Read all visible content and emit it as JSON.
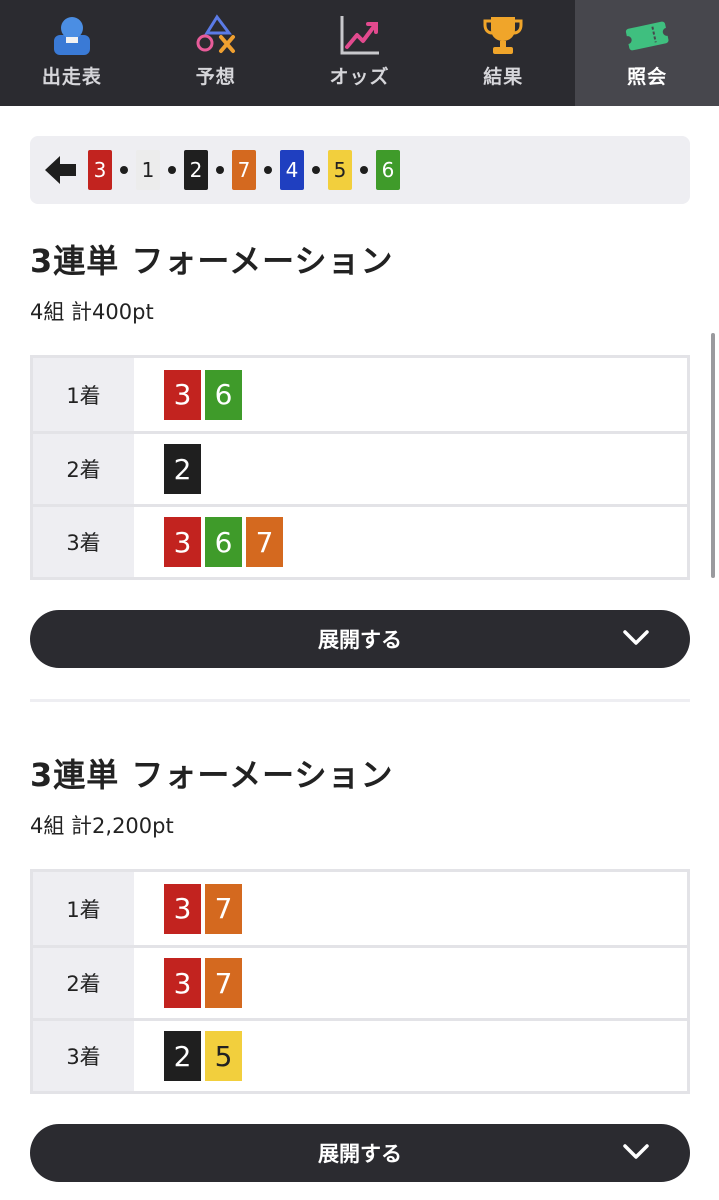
{
  "nav": {
    "items": [
      {
        "label": "出走表",
        "icon": "person-icon",
        "active": false
      },
      {
        "label": "予想",
        "icon": "prediction-icon",
        "active": false
      },
      {
        "label": "オッズ",
        "icon": "chart-icon",
        "active": false
      },
      {
        "label": "結果",
        "icon": "trophy-icon",
        "active": false
      },
      {
        "label": "照会",
        "icon": "ticket-icon",
        "active": true
      }
    ]
  },
  "order_bar": {
    "numbers": [
      "3",
      "1",
      "2",
      "7",
      "4",
      "5",
      "6"
    ]
  },
  "colors": {
    "1": {
      "bg": "#ececec",
      "fg": "#222222"
    },
    "2": {
      "bg": "#1f1f1f",
      "fg": "#ffffff"
    },
    "3": {
      "bg": "#c2231f",
      "fg": "#ffffff"
    },
    "4": {
      "bg": "#1f3fc0",
      "fg": "#ffffff"
    },
    "5": {
      "bg": "#f2cf3d",
      "fg": "#222222"
    },
    "6": {
      "bg": "#3f9b2a",
      "fg": "#ffffff"
    },
    "7": {
      "bg": "#d4691f",
      "fg": "#ffffff"
    }
  },
  "sections": [
    {
      "title": "3連単 フォーメーション",
      "subtitle": "4組 計400pt",
      "rows": [
        {
          "label": "1着",
          "numbers": [
            "3",
            "6"
          ]
        },
        {
          "label": "2着",
          "numbers": [
            "2"
          ]
        },
        {
          "label": "3着",
          "numbers": [
            "3",
            "6",
            "7"
          ]
        }
      ],
      "expand_label": "展開する"
    },
    {
      "title": "3連単 フォーメーション",
      "subtitle": "4組 計2,200pt",
      "rows": [
        {
          "label": "1着",
          "numbers": [
            "3",
            "7"
          ]
        },
        {
          "label": "2着",
          "numbers": [
            "3",
            "7"
          ]
        },
        {
          "label": "3着",
          "numbers": [
            "2",
            "5"
          ]
        }
      ],
      "expand_label": "展開する"
    }
  ]
}
